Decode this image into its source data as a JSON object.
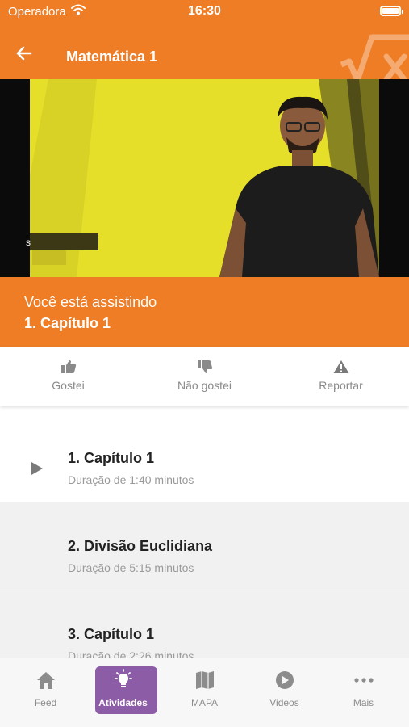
{
  "status_bar": {
    "carrier": "Operadora",
    "time": "16:30"
  },
  "header": {
    "title": "Matemática 1",
    "back_icon": "arrow-left-icon",
    "brand_icon": "sqrt-x-icon"
  },
  "video": {
    "lower_third_text": "s"
  },
  "now_playing": {
    "label": "Você está assistindo",
    "title": "1. Capítulo 1"
  },
  "actions": [
    {
      "label": "Gostei",
      "icon": "thumbs-up-icon"
    },
    {
      "label": "Não gostei",
      "icon": "thumbs-down-icon"
    },
    {
      "label": "Reportar",
      "icon": "warning-icon"
    }
  ],
  "lessons": [
    {
      "title": "1. Capítulo 1",
      "duration": "Duração de 1:40 minutos",
      "playing": true
    },
    {
      "title": "2. Divisão Euclidiana",
      "duration": "Duração de 5:15 minutos",
      "playing": false
    },
    {
      "title": "3. Capítulo 1",
      "duration": "Duração de 2:26 minutos",
      "playing": false
    }
  ],
  "tabs": [
    {
      "label": "Feed",
      "icon": "home-icon",
      "selected": false
    },
    {
      "label": "Atividades",
      "icon": "lightbulb-icon",
      "selected": true
    },
    {
      "label": "MAPA",
      "icon": "map-icon",
      "selected": false
    },
    {
      "label": "Videos",
      "icon": "play-circle-icon",
      "selected": false
    },
    {
      "label": "Mais",
      "icon": "more-icon",
      "selected": false
    }
  ],
  "colors": {
    "brand_orange": "#ee7d26",
    "selected_tab": "#8c5ca6",
    "video_yellow": "#e6df2a"
  }
}
